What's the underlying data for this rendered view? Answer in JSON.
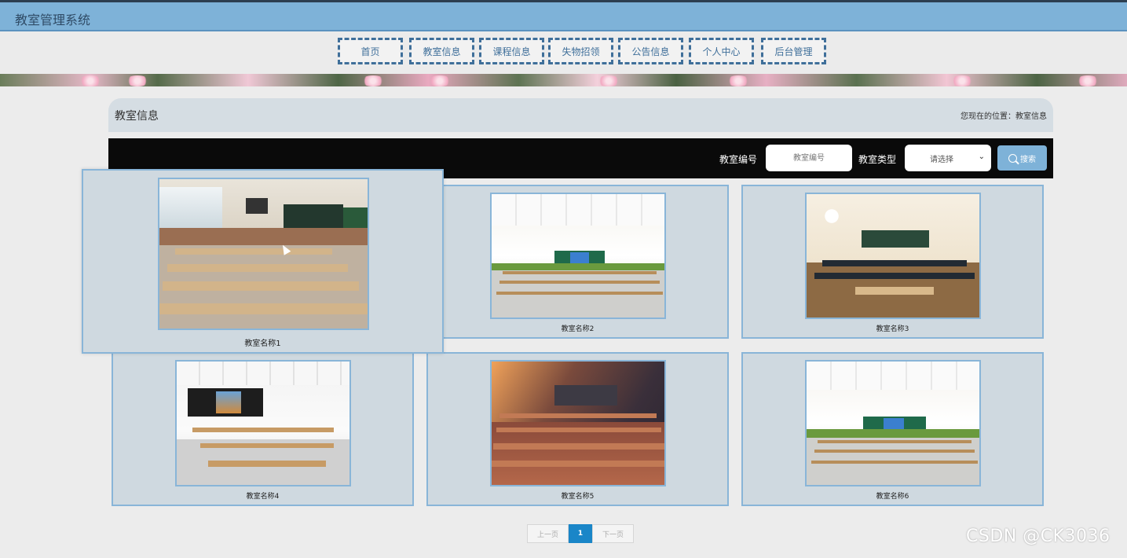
{
  "header": {
    "site_title": "教室管理系统"
  },
  "nav": {
    "items": [
      {
        "label": "首页"
      },
      {
        "label": "教室信息"
      },
      {
        "label": "课程信息"
      },
      {
        "label": "失物招领"
      },
      {
        "label": "公告信息"
      },
      {
        "label": "个人中心"
      },
      {
        "label": "后台管理"
      }
    ]
  },
  "breadcrumb": {
    "title": "教室信息",
    "location": "您现在的位置：教室信息"
  },
  "search": {
    "number_label": "教室编号",
    "number_placeholder": "教室编号",
    "type_label": "教室类型",
    "type_selected": "请选择",
    "button_label": "搜索",
    "icons": {
      "search": "search-icon",
      "select": "chevron-down-icon"
    }
  },
  "cards": [
    {
      "caption": "教室名称1"
    },
    {
      "caption": "教室名称2"
    },
    {
      "caption": "教室名称3"
    },
    {
      "caption": "教室名称4"
    },
    {
      "caption": "教室名称5"
    },
    {
      "caption": "教室名称6"
    }
  ],
  "pagination": {
    "prev": "上一页",
    "current": "1",
    "next": "下一页"
  },
  "watermark": "CSDN @CK3036",
  "colors": {
    "header": "#7eb2d8",
    "nav_border": "#3f6f9a",
    "card_bg": "#cfd9e0",
    "card_border": "#89b5d8",
    "page_active": "#1a86c8"
  }
}
